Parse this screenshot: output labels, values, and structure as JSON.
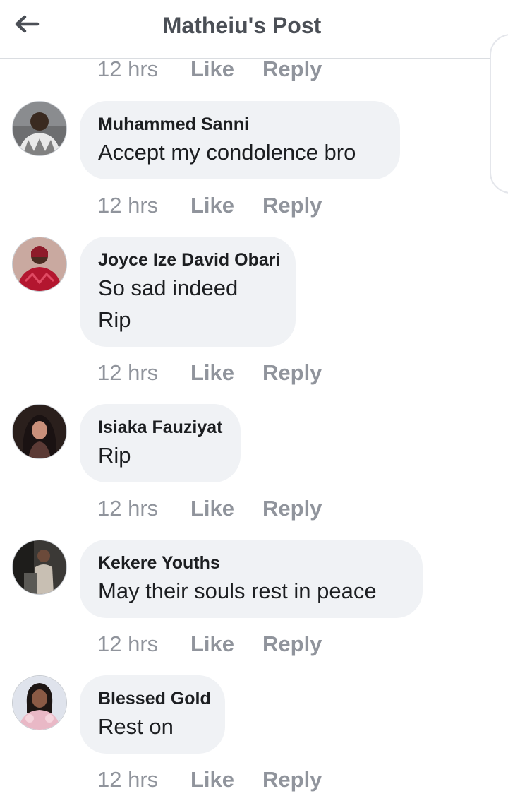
{
  "header": {
    "title": "Matheiu's Post",
    "back_icon": "arrow-left-icon"
  },
  "colors": {
    "bubble": "#f0f2f5",
    "meta_text": "#90949c",
    "title_text": "#4b4f56"
  },
  "top_meta": {
    "time": "12 hrs",
    "like": "Like",
    "reply": "Reply"
  },
  "comments": [
    {
      "author": "Muhammed Sanni",
      "text": "Accept my condolence bro",
      "time": "12 hrs",
      "like": "Like",
      "reply": "Reply"
    },
    {
      "author": "Joyce Ize David Obari",
      "text": "So sad indeed\nRip",
      "time": "12 hrs",
      "like": "Like",
      "reply": "Reply"
    },
    {
      "author": "Isiaka Fauziyat",
      "text": "Rip",
      "time": "12 hrs",
      "like": "Like",
      "reply": "Reply"
    },
    {
      "author": "Kekere Youths",
      "text": "May their souls rest in peace",
      "time": "12 hrs",
      "like": "Like",
      "reply": "Reply"
    },
    {
      "author": "Blessed Gold",
      "text": "Rest on",
      "time": "12 hrs",
      "like": "Like",
      "reply": "Reply"
    }
  ]
}
